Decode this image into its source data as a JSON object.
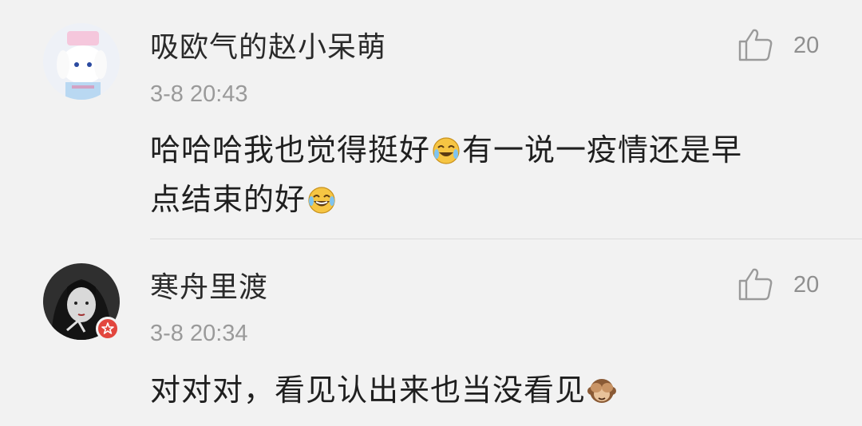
{
  "comments": [
    {
      "username": "吸欧气的赵小呆萌",
      "time": "3-8 20:43",
      "text_part1": "哈哈哈我也觉得挺好",
      "text_part2": "有一说一疫情还是早",
      "text_part3": "点结束的好",
      "likes": "20",
      "emoji1": "crying-laughing-emoji",
      "emoji2": "tears-of-joy-emoji"
    },
    {
      "username": "寒舟里渡",
      "time": "3-8 20:34",
      "text_part1": "对对对，看见认出来也当没看见",
      "likes": "20",
      "emoji1": "see-no-evil-monkey-emoji"
    }
  ],
  "colors": {
    "background": "#f2f2f2",
    "username": "#2a2a2a",
    "meta": "#9a9a9a",
    "badge": "#e2463e"
  }
}
